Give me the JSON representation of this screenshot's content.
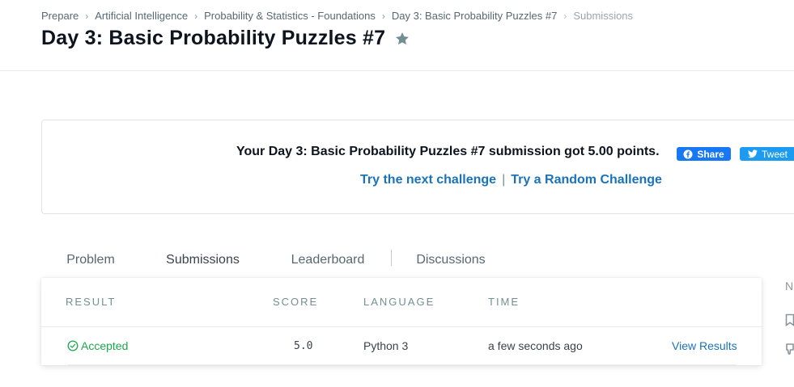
{
  "breadcrumb": {
    "items": [
      "Prepare",
      "Artificial Intelligence",
      "Probability & Statistics - Foundations",
      "Day 3: Basic Probability Puzzles #7"
    ],
    "current": "Submissions"
  },
  "header": {
    "title": "Day 3: Basic Probability Puzzles #7",
    "star_icon": "star-icon"
  },
  "result": {
    "message": "Your Day 3: Basic Probability Puzzles #7 submission got 5.00 points.",
    "share_label": "Share",
    "tweet_label": "Tweet",
    "next_challenge": "Try the next challenge",
    "separator": "|",
    "random_challenge": "Try a Random Challenge"
  },
  "tabs": [
    {
      "label": "Problem"
    },
    {
      "label": "Submissions",
      "active": true
    },
    {
      "label": "Leaderboard"
    },
    {
      "label": "Discussions"
    }
  ],
  "submissions": {
    "columns": [
      "RESULT",
      "SCORE",
      "LANGUAGE",
      "TIME"
    ],
    "rows": [
      {
        "status": "Accepted",
        "score": "5.0",
        "language": "Python 3",
        "time": "a few seconds ago",
        "action": "View Results"
      }
    ]
  },
  "side": {
    "letter": "N"
  },
  "colors": {
    "accent": "#1a73b8",
    "success": "#1ba94c",
    "facebook": "#1877f2",
    "twitter": "#1d9bf0"
  }
}
